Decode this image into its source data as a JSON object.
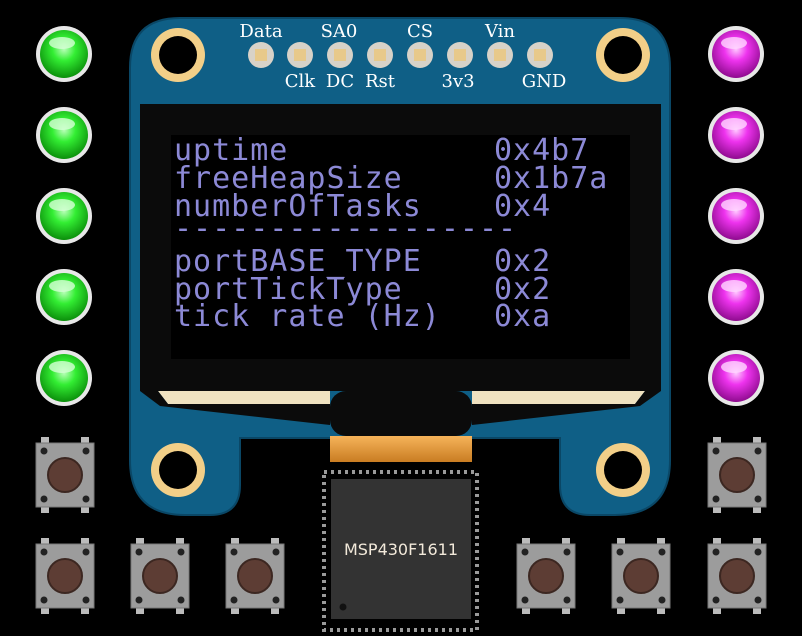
{
  "oled": {
    "pin_labels_top": [
      "Data",
      "SA0",
      "CS",
      "Vin"
    ],
    "pin_labels_bottom": [
      "Clk",
      "DC",
      "Rst",
      "3v3",
      "GND"
    ],
    "rows": [
      {
        "key": "uptime",
        "value": "0x4b7"
      },
      {
        "key": "freeHeapSize",
        "value": "0x1b7a"
      },
      {
        "key": "numberOfTasks",
        "value": "0x4"
      },
      {
        "divider": "------------------"
      },
      {
        "key": "portBASE_TYPE",
        "value": "0x2"
      },
      {
        "key": "portTickType",
        "value": "0x2"
      },
      {
        "key": "tick rate (Hz)",
        "value": "0xa"
      }
    ]
  },
  "mcu": {
    "label": "MSP430F1611"
  },
  "leds": {
    "left_color": "green",
    "right_color": "magenta",
    "left": [
      {
        "on": true
      },
      {
        "on": true
      },
      {
        "on": true
      },
      {
        "on": true
      },
      {
        "on": true
      }
    ],
    "right": [
      {
        "on": true
      },
      {
        "on": true
      },
      {
        "on": true
      },
      {
        "on": true
      },
      {
        "on": true
      }
    ]
  },
  "colors": {
    "board": "#0f5f86",
    "pad": "#f2cf88",
    "text": "#8c89d6",
    "green": "#22dd22",
    "magenta": "#dd22dd"
  }
}
